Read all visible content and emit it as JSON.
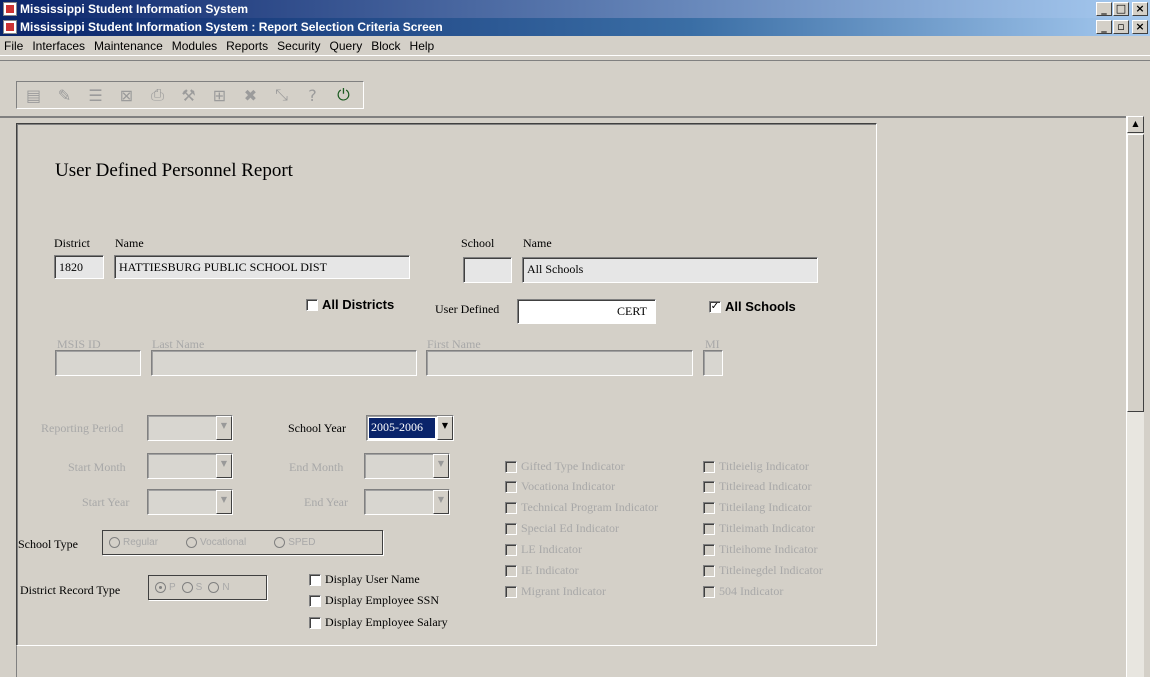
{
  "window": {
    "outer_title": "Mississippi Student Information System",
    "inner_title": "Mississippi Student Information System : Report Selection Criteria Screen",
    "outer_buttons": [
      "_",
      "□",
      "×"
    ],
    "inner_buttons": [
      "_",
      "▫",
      "×"
    ]
  },
  "menu": [
    "File",
    "Interfaces",
    "Maintenance",
    "Modules",
    "Reports",
    "Security",
    "Query",
    "Block",
    "Help"
  ],
  "toolbar": [
    {
      "icon": "save-icon",
      "glyph": "▤"
    },
    {
      "icon": "edit-icon",
      "glyph": "✎"
    },
    {
      "icon": "list-icon",
      "glyph": "☰"
    },
    {
      "icon": "clear-icon",
      "glyph": "⊠"
    },
    {
      "icon": "print-icon",
      "glyph": "⎙"
    },
    {
      "icon": "tool-icon",
      "glyph": "⚒"
    },
    {
      "icon": "query-icon",
      "glyph": "⊞"
    },
    {
      "icon": "delete-icon",
      "glyph": "✖"
    },
    {
      "icon": "cancel-icon",
      "glyph": "⤡"
    },
    {
      "icon": "help-icon",
      "glyph": "?"
    },
    {
      "icon": "exit-icon",
      "glyph": "⏻"
    }
  ],
  "form": {
    "heading": "User Defined Personnel Report",
    "district_label": "District",
    "district_name_label": "Name",
    "district_code": "1820",
    "district_name": "HATTIESBURG PUBLIC SCHOOL DIST",
    "school_label": "School",
    "school_name_label": "Name",
    "school_code": "",
    "school_name": "All Schools",
    "all_districts_label": "All Districts",
    "user_defined_label": "User Defined",
    "user_defined_value": "CERT",
    "all_schools_label": "All Schools",
    "msis_id_label": "MSIS ID",
    "last_name_label": "Last Name",
    "first_name_label": "First Name",
    "mi_label": "MI",
    "reporting_period_label": "Reporting Period",
    "school_year_label": "School Year",
    "school_year_value": "2005-2006",
    "start_month_label": "Start Month",
    "end_month_label": "End Month",
    "start_year_label": "Start Year",
    "end_year_label": "End Year",
    "school_type_label": "School Type",
    "school_types": [
      "Regular",
      "Vocational",
      "SPED"
    ],
    "district_record_type_label": "District Record Type",
    "district_record_types": [
      "P",
      "S",
      "N"
    ],
    "display_user_name": "Display User Name",
    "display_employee_ssn": "Display Employee SSN",
    "display_employee_salary": "Display Employee Salary",
    "indicators_left": [
      "Gifted Type Indicator",
      "Vocationa Indicator",
      "Technical Program Indicator",
      "Special Ed Indicator",
      "LE Indicator",
      "IE Indicator",
      "Migrant Indicator"
    ],
    "indicators_right": [
      "Titleielig Indicator",
      "Titleiread Indicator",
      "Titleilang Indicator",
      "Titleimath Indicator",
      "Titleihome Indicator",
      "Titleinegdel Indicator",
      "504 Indicator"
    ]
  }
}
